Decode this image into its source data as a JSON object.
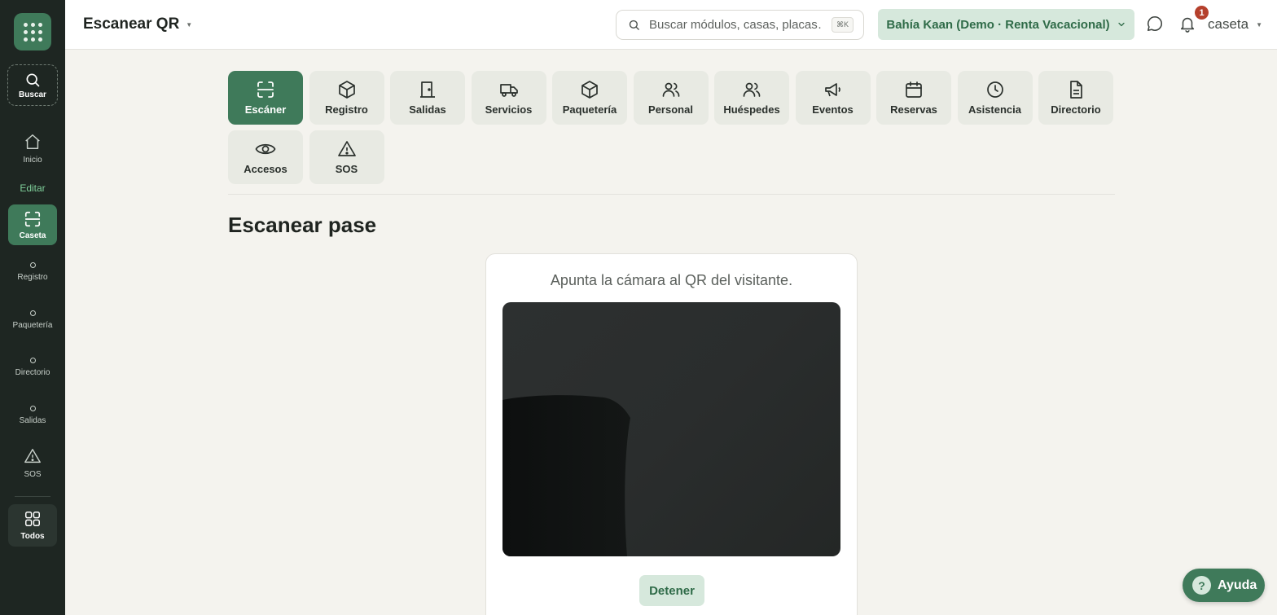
{
  "sidebar": {
    "search_label": "Buscar",
    "inicio_label": "Inicio",
    "edit_label": "Editar",
    "active_label": "Caseta",
    "shortcuts": [
      {
        "label": "Registro"
      },
      {
        "label": "Paquetería"
      },
      {
        "label": "Directorio"
      },
      {
        "label": "Salidas"
      }
    ],
    "sos_label": "SOS",
    "all_label": "Todos"
  },
  "header": {
    "title": "Escanear QR",
    "search_placeholder": "Buscar módulos, casas, placas…",
    "search_shortcut": "⌘K",
    "property_name": "Bahía Kaan (Demo · Renta Vacacional)",
    "notification_count": "1",
    "user_name": "caseta"
  },
  "modules": [
    {
      "label": "Escáner",
      "icon": "scan-icon",
      "active": true
    },
    {
      "label": "Registro",
      "icon": "box-icon"
    },
    {
      "label": "Salidas",
      "icon": "door-icon"
    },
    {
      "label": "Servicios",
      "icon": "truck-icon"
    },
    {
      "label": "Paquetería",
      "icon": "package-icon"
    },
    {
      "label": "Personal",
      "icon": "users-icon"
    },
    {
      "label": "Huéspedes",
      "icon": "guests-icon"
    },
    {
      "label": "Eventos",
      "icon": "megaphone-icon"
    },
    {
      "label": "Reservas",
      "icon": "calendar-icon"
    },
    {
      "label": "Asistencia",
      "icon": "clock-icon"
    },
    {
      "label": "Directorio",
      "icon": "document-icon"
    },
    {
      "label": "Accesos",
      "icon": "eye-icon"
    },
    {
      "label": "SOS",
      "icon": "warning-icon"
    }
  ],
  "main": {
    "section_title": "Escanear pase",
    "instruction": "Apunta la cámara al QR del visitante.",
    "stop_label": "Detener"
  },
  "help": {
    "label": "Ayuda",
    "glyph": "?"
  },
  "colors": {
    "sidebar_bg": "#1e2622",
    "accent": "#3f7a5a",
    "accent_light": "#d6e8dc",
    "page_bg": "#f4f3ee",
    "badge": "#b5402c"
  }
}
